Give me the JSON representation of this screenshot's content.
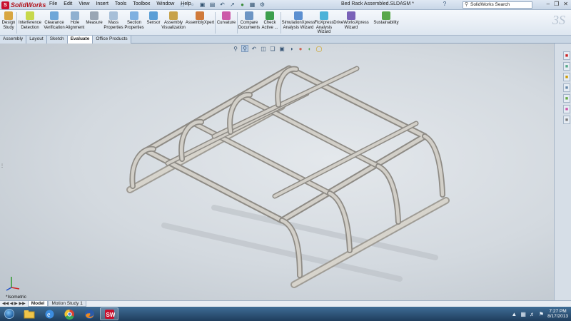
{
  "app": {
    "logo_text": "SolidWorks",
    "logo_mark": "S",
    "document_title": "Bed Rack Assembled.SLDASM *",
    "search_placeholder": "SolidWorks Search",
    "menus": [
      "File",
      "Edit",
      "View",
      "Insert",
      "Tools",
      "Toolbox",
      "Window",
      "Help"
    ]
  },
  "command_manager": {
    "items": [
      {
        "label": "Design Study",
        "icon": "design-study-icon",
        "color": "#d8a642"
      },
      {
        "label": "Interference Detection",
        "icon": "interference-icon",
        "color": "#c7d84b"
      },
      {
        "label": "Clearance Verification",
        "icon": "clearance-icon",
        "color": "#6fa7d8"
      },
      {
        "label": "Hole Alignment",
        "icon": "hole-alignment-icon",
        "color": "#8fb0d0"
      },
      {
        "label": "Measure",
        "icon": "measure-icon",
        "color": "#9aa6b4"
      },
      {
        "label": "Mass Properties",
        "icon": "mass-properties-icon",
        "color": "#a7bfd8"
      },
      {
        "label": "Section Properties",
        "icon": "section-properties-icon",
        "color": "#7fb0e0"
      },
      {
        "label": "Sensor",
        "icon": "sensor-icon",
        "color": "#5a9ed6"
      },
      {
        "label": "Assembly Visualization",
        "icon": "assembly-visualization-icon",
        "color": "#c7a24a"
      },
      {
        "label": "AssemblyXpert",
        "icon": "assemblyxpert-icon",
        "color": "#d07a3a"
      },
      {
        "label": "Curvature",
        "icon": "curvature-icon",
        "color": "#cc5aa8"
      },
      {
        "label": "Compare Documents",
        "icon": "compare-documents-icon",
        "color": "#6d95c4"
      },
      {
        "label": "Check Active ...",
        "icon": "check-active-icon",
        "color": "#3d9f4d"
      },
      {
        "label": "SimulationXpress Analysis Wizard",
        "icon": "simulationxpress-icon",
        "color": "#5c8fd0"
      },
      {
        "label": "FloXpress Analysis Wizard",
        "icon": "floxpress-icon",
        "color": "#4bb2d8"
      },
      {
        "label": "DriveWorksXpress Wizard",
        "icon": "driveworksxpress-icon",
        "color": "#7a62b8"
      },
      {
        "label": "Sustainability",
        "icon": "sustainability-icon",
        "color": "#59a84a"
      }
    ]
  },
  "tabs": [
    "Assembly",
    "Layout",
    "Sketch",
    "Evaluate",
    "Office Products"
  ],
  "active_tab": "Evaluate",
  "viewport": {
    "view_label": "*Isometric",
    "part_color": "#c9c6bf"
  },
  "bottom_tabs": [
    "Model",
    "Motion Study 1"
  ],
  "taskbar": {
    "time": "7:27 PM",
    "date": "8/17/2013",
    "apps": [
      "file-explorer-icon",
      "internet-explorer-icon",
      "chrome-icon",
      "firefox-icon",
      "solidworks-icon"
    ]
  }
}
